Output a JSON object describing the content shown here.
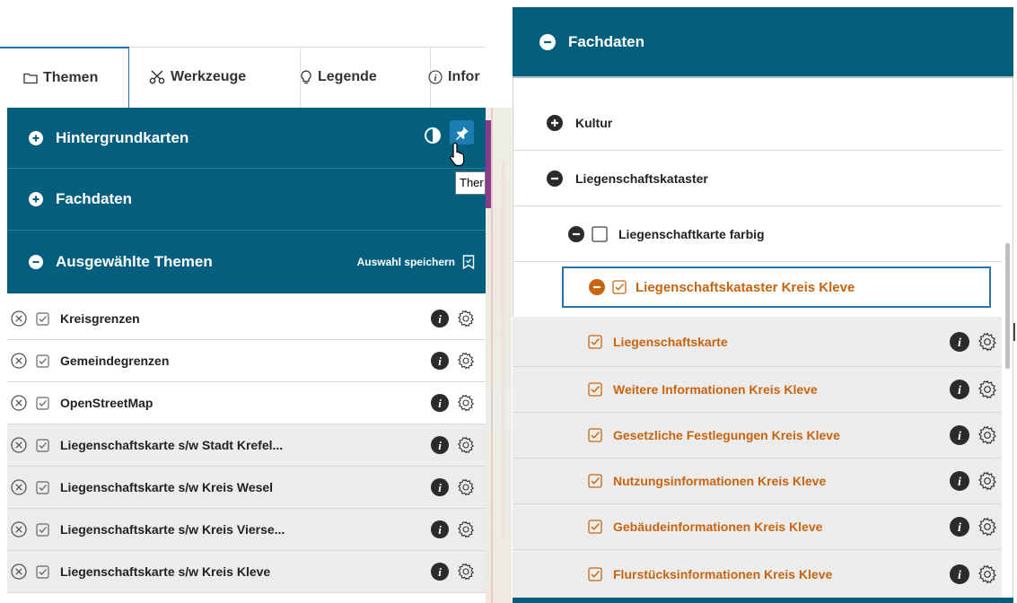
{
  "left_panel": {
    "tabs": [
      {
        "label": "Themen",
        "icon": "folder-icon"
      },
      {
        "label": "Werkzeuge",
        "icon": "scissors-icon"
      },
      {
        "label": "Legende",
        "icon": "bulb-icon"
      },
      {
        "label": "Infor",
        "icon": "info-circle-icon"
      }
    ],
    "sections": {
      "hintergrund": {
        "title": "Hintergrundkarten",
        "state": "collapsed"
      },
      "fachdaten": {
        "title": "Fachdaten",
        "state": "collapsed"
      },
      "ausgewaehlt": {
        "title": "Ausgewählte Themen",
        "state": "expanded",
        "save_label": "Auswahl speichern"
      }
    },
    "tooltip": "Ther",
    "selected_layers": [
      {
        "label": "Kreisgrenzen"
      },
      {
        "label": "Gemeindegrenzen"
      },
      {
        "label": "OpenStreetMap"
      },
      {
        "label": "Liegenschaftskarte s/w Stadt Krefel..."
      },
      {
        "label": "Liegenschaftskarte s/w Kreis Wesel"
      },
      {
        "label": "Liegenschaftskarte s/w Kreis Vierse..."
      },
      {
        "label": "Liegenschaftskarte s/w Kreis Kleve"
      }
    ]
  },
  "right_panel": {
    "header": {
      "title": "Fachdaten",
      "state": "expanded"
    },
    "tree": {
      "kultur": {
        "label": "Kultur",
        "state": "collapsed"
      },
      "liegenschaftskataster": {
        "label": "Liegenschaftskataster",
        "state": "expanded"
      },
      "karte_farbig": {
        "label": "Liegenschaftkarte farbig",
        "checked": false
      },
      "kataster_kleve": {
        "label": "Liegenschaftskataster Kreis Kleve",
        "checked": true
      },
      "layers": [
        {
          "label": "Liegenschaftskarte"
        },
        {
          "label": "Weitere Informationen Kreis Kleve"
        },
        {
          "label": "Gesetzliche Festlegungen Kreis Kleve"
        },
        {
          "label": "Nutzungsinformationen Kreis Kleve"
        },
        {
          "label": "Gebäudeinformationen Kreis Kleve"
        },
        {
          "label": "Flurstücksinformationen Kreis Kleve"
        }
      ]
    }
  },
  "colors": {
    "header_bg": "#045f7f",
    "accent_orange": "#c8640f",
    "focus_blue": "#2a6fb0",
    "row_grey": "#ececec"
  }
}
